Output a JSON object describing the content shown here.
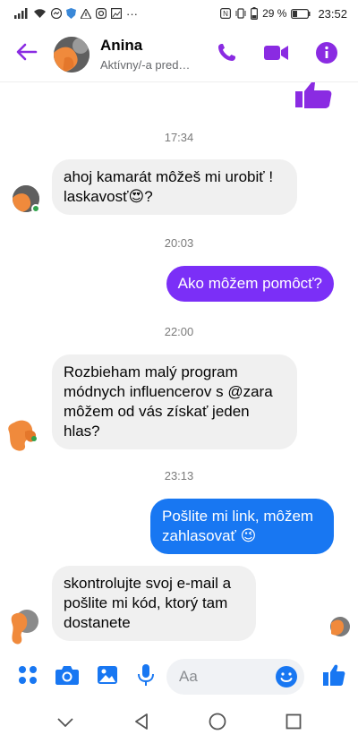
{
  "status_bar": {
    "battery": "29 %",
    "time": "23:52",
    "more": "···"
  },
  "header": {
    "contact_name": "Anina",
    "contact_status": "Aktívny/-a pred…"
  },
  "colors": {
    "accent": "#8a2be2",
    "purple_bubble": "#7b2ff7",
    "blue_bubble": "#1877f2",
    "incoming_bubble": "#f0f0f0",
    "online": "#31a24c",
    "icon_blue": "#1877f2"
  },
  "messages": [
    {
      "type": "timestamp",
      "text": "17:34"
    },
    {
      "type": "incoming",
      "text": "ahoj kamarát môžeš mi urobiť ! laskavosť😍?"
    },
    {
      "type": "timestamp",
      "text": "20:03"
    },
    {
      "type": "outgoing",
      "text": "Ako môžem pomôcť?"
    },
    {
      "type": "timestamp",
      "text": "22:00"
    },
    {
      "type": "incoming",
      "text": "Rozbieham malý program módnych influencerov s @zara môžem od vás získať jeden hlas?"
    },
    {
      "type": "timestamp",
      "text": "23:13"
    },
    {
      "type": "outgoing",
      "text": "Pošlite mi link, môžem zahlasovať 😉"
    },
    {
      "type": "incoming",
      "text": "skontrolujte svoj e-mail a pošlite mi kód, ktorý tam dostanete"
    }
  ],
  "composer": {
    "placeholder": "Aa"
  },
  "icons": {
    "back": "arrow-left-icon",
    "call": "phone-icon",
    "video": "video-camera-icon",
    "info": "info-icon",
    "menu": "four-dots-icon",
    "camera": "camera-icon",
    "gallery": "image-icon",
    "mic": "microphone-icon",
    "emoji": "smiley-icon",
    "like": "thumbs-up-icon"
  }
}
